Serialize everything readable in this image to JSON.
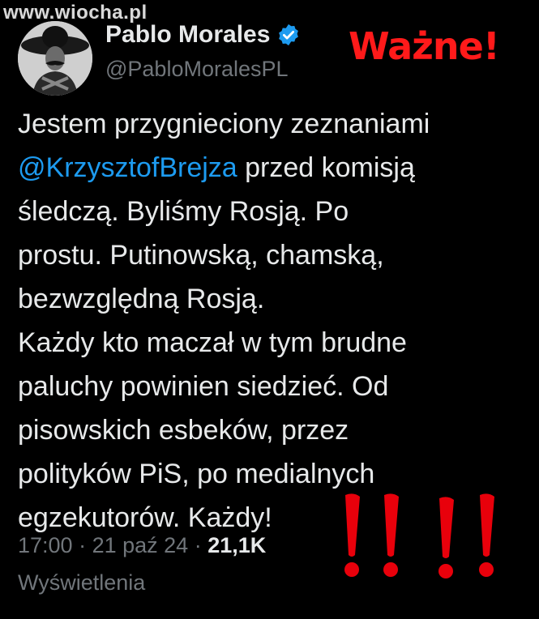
{
  "watermark": "www.wiocha.pl",
  "tweet": {
    "author": {
      "display_name": "Pablo Morales",
      "handle": "@PabloMoralesPL",
      "verified_icon": "verified-badge-icon",
      "avatar": "avatar-image"
    },
    "annotation": "Ważne!",
    "text_lines": [
      {
        "plain": "Jestem przygnieciony zeznaniami"
      },
      {
        "mention": "@KrzysztofBrejza",
        "plain": " przed komisją"
      },
      {
        "plain": "śledczą. Byliśmy Rosją. Po"
      },
      {
        "plain": "prostu. Putinowską, chamską,"
      },
      {
        "plain": "bezwzględną Rosją."
      },
      {
        "plain": "Każdy kto maczał w tym brudne"
      },
      {
        "plain": "paluchy powinien siedzieć. Od"
      },
      {
        "plain": "pisowskich esbeków, przez"
      },
      {
        "plain": "polityków PiS, po medialnych"
      },
      {
        "plain": "egzekutorów. Każdy!"
      }
    ],
    "meta": {
      "time": "17:00",
      "separator": " · ",
      "date": "21 paź 24",
      "views_count": "21,1K",
      "views_label": "Wyświetlenia"
    }
  },
  "colors": {
    "background": "#000000",
    "text": "#e7e9ea",
    "muted": "#71767b",
    "mention": "#1d9bf0",
    "annotation_red": "#ff1a1a",
    "verified_blue": "#1d9bf0"
  },
  "decorations": {
    "exclamation_marks_icon": "red-exclamation-marks-icon",
    "exclamation_count": 4
  }
}
